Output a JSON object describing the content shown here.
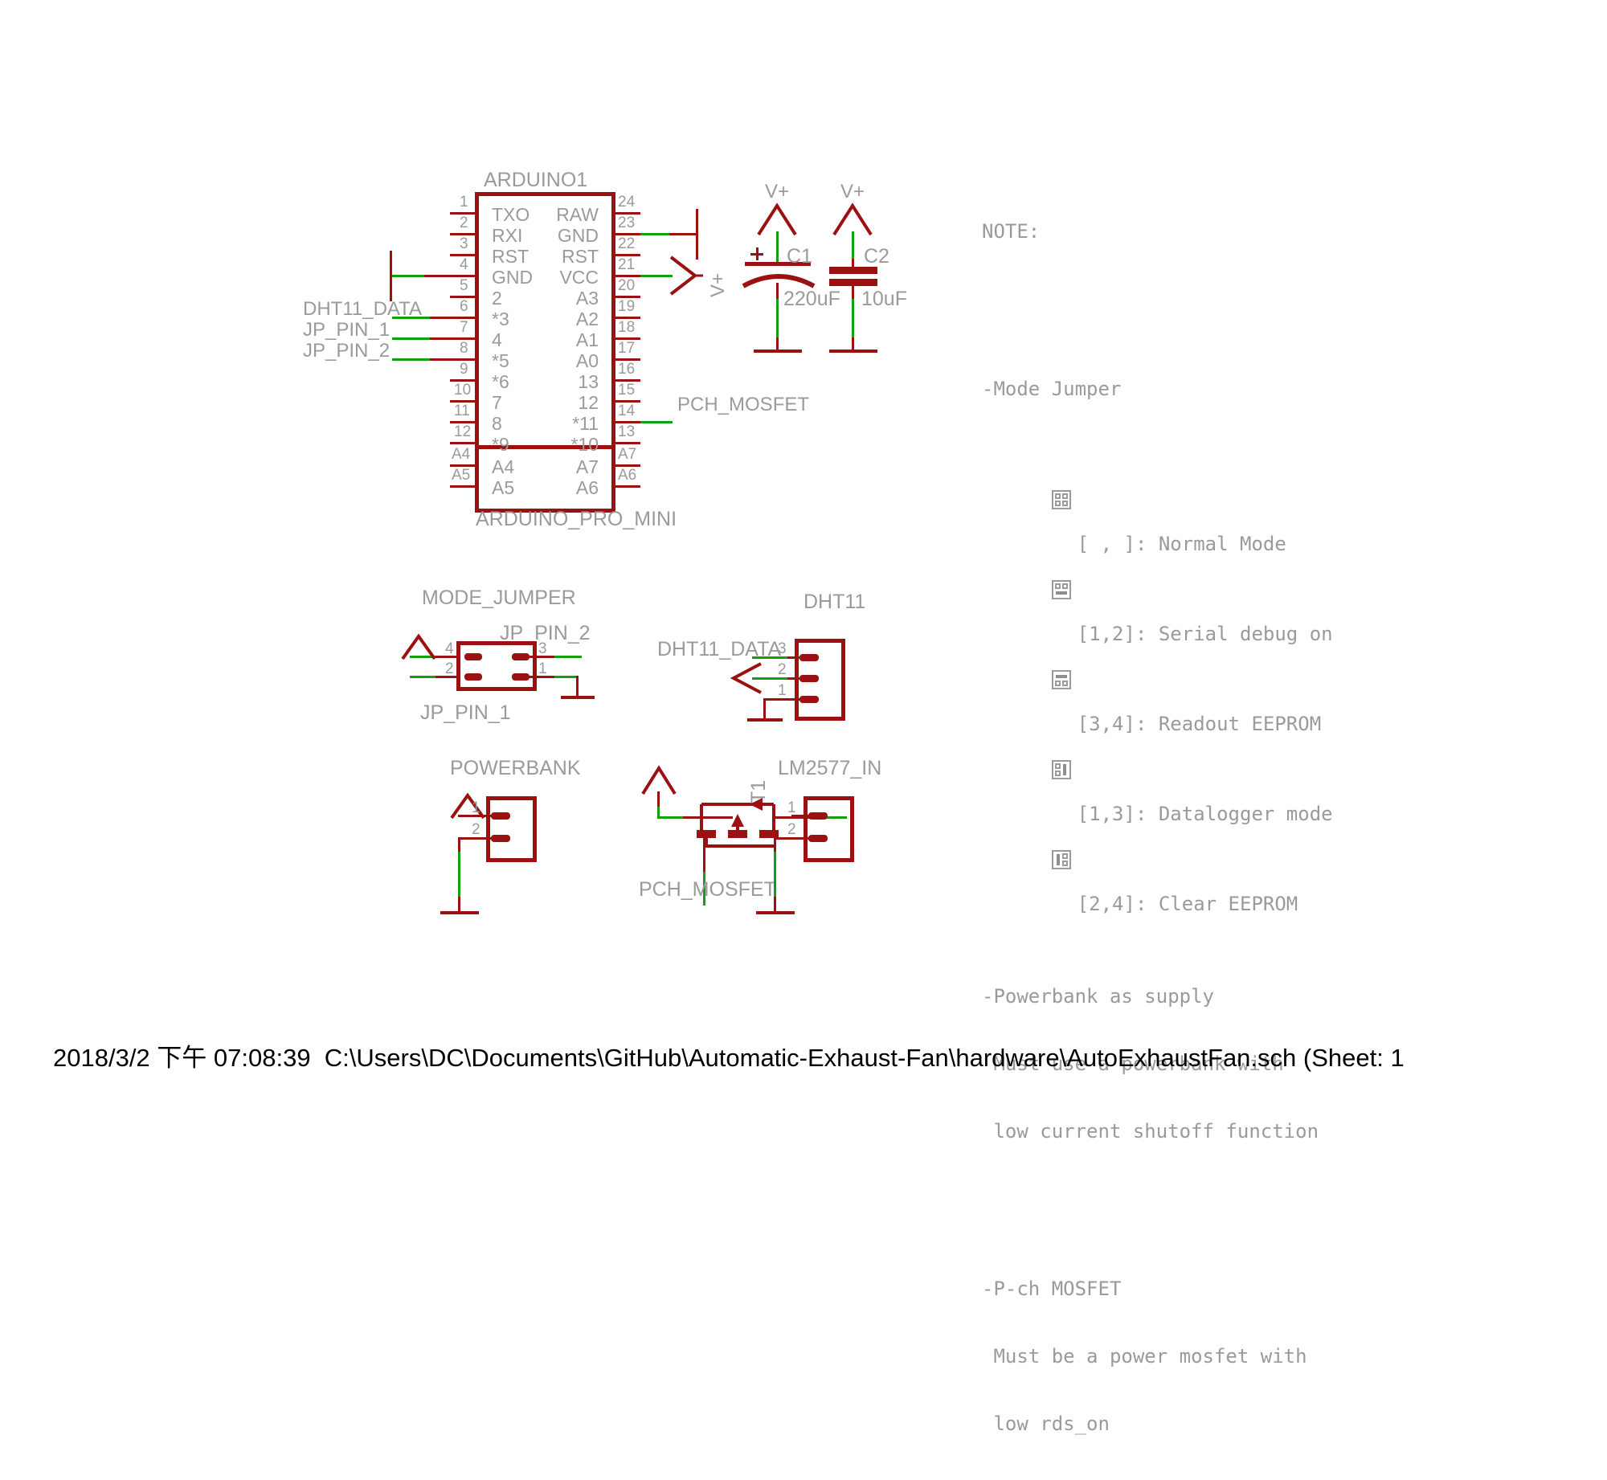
{
  "document": {
    "footer": "2018/3/2 下午 07:08:39  C:\\Users\\DC\\Documents\\GitHub\\Automatic-Exhaust-Fan\\hardware\\AutoExhaustFan.sch (Sheet: 1"
  },
  "arduino": {
    "ref": "ARDUINO1",
    "device": "ARDUINO_PRO_MINI",
    "left_pins": [
      {
        "num": "1",
        "name": "TXO"
      },
      {
        "num": "2",
        "name": "RXI"
      },
      {
        "num": "3",
        "name": "RST"
      },
      {
        "num": "4",
        "name": "GND"
      },
      {
        "num": "5",
        "name": "2"
      },
      {
        "num": "6",
        "name": "*3"
      },
      {
        "num": "7",
        "name": "4"
      },
      {
        "num": "8",
        "name": "*5"
      },
      {
        "num": "9",
        "name": "*6"
      },
      {
        "num": "10",
        "name": "7"
      },
      {
        "num": "11",
        "name": "8"
      },
      {
        "num": "12",
        "name": "*9"
      }
    ],
    "right_pins": [
      {
        "num": "24",
        "name": "RAW"
      },
      {
        "num": "23",
        "name": "GND"
      },
      {
        "num": "22",
        "name": "RST"
      },
      {
        "num": "21",
        "name": "VCC"
      },
      {
        "num": "20",
        "name": "A3"
      },
      {
        "num": "19",
        "name": "A2"
      },
      {
        "num": "18",
        "name": "A1"
      },
      {
        "num": "17",
        "name": "A0"
      },
      {
        "num": "16",
        "name": "13"
      },
      {
        "num": "15",
        "name": "12"
      },
      {
        "num": "14",
        "name": "*11"
      },
      {
        "num": "13",
        "name": "*10"
      }
    ],
    "analog_left": [
      {
        "num": "A4",
        "name": "A4"
      },
      {
        "num": "A5",
        "name": "A5"
      }
    ],
    "analog_right": [
      {
        "num": "A7",
        "name": "A7"
      },
      {
        "num": "A6",
        "name": "A6"
      }
    ],
    "nets": {
      "dht11_data": "DHT11_DATA",
      "jp_pin_1": "JP_PIN_1",
      "jp_pin_2": "JP_PIN_2",
      "pch_mosfet": "PCH_MOSFET",
      "vplus": "V+"
    }
  },
  "capacitors": [
    {
      "ref": "C1",
      "value": "220uF",
      "supply": "V+",
      "polarity": "+",
      "type": "electrolytic"
    },
    {
      "ref": "C2",
      "value": "10uF",
      "supply": "V+",
      "polarity": "",
      "type": "ceramic"
    }
  ],
  "note": {
    "title": "NOTE:",
    "sections": [
      {
        "heading": "-Mode Jumper",
        "items": [
          {
            "icon": "jumper-none",
            "text": "[ , ]: Normal Mode"
          },
          {
            "icon": "jumper-1-2",
            "text": "[1,2]: Serial debug on"
          },
          {
            "icon": "jumper-3-4",
            "text": "[3,4]: Readout EEPROM"
          },
          {
            "icon": "jumper-1-3",
            "text": "[1,3]: Datalogger mode"
          },
          {
            "icon": "jumper-2-4",
            "text": "[2,4]: Clear EEPROM"
          }
        ]
      },
      {
        "heading": "-Powerbank as supply",
        "lines": [
          " Must use a powerbank with",
          " low current shutoff function"
        ]
      },
      {
        "heading": "-P-ch MOSFET",
        "lines": [
          " Must be a power mosfet with",
          " low rds_on"
        ]
      }
    ]
  },
  "mode_jumper": {
    "title": "MODE_JUMPER",
    "pins": [
      {
        "num": "4",
        "side": "left",
        "net": ""
      },
      {
        "num": "2",
        "side": "left",
        "net": "JP_PIN_1"
      },
      {
        "num": "3",
        "side": "right",
        "net": "JP_PIN_2"
      },
      {
        "num": "1",
        "side": "right",
        "net": ""
      }
    ],
    "label_top": "JP_PIN_2",
    "label_bottom": "JP_PIN_1"
  },
  "dht11": {
    "title": "DHT11",
    "pins": [
      {
        "num": "3",
        "net": "DHT11_DATA"
      },
      {
        "num": "2",
        "net": ""
      },
      {
        "num": "1",
        "net": ""
      }
    ],
    "net_label": "DHT11_DATA"
  },
  "powerbank": {
    "title": "POWERBANK",
    "pins": [
      {
        "num": "1"
      },
      {
        "num": "2"
      }
    ]
  },
  "mosfet": {
    "ref": "T1",
    "net_label": "PCH_MOSFET"
  },
  "lm2577": {
    "title": "LM2577_IN",
    "pins": [
      {
        "num": "1"
      },
      {
        "num": "2"
      }
    ]
  },
  "colors": {
    "wire": "#9b1111",
    "net_highlight": "#12a012",
    "text": "#9a9a9a",
    "footer_text": "#000000",
    "background": "#ffffff"
  }
}
